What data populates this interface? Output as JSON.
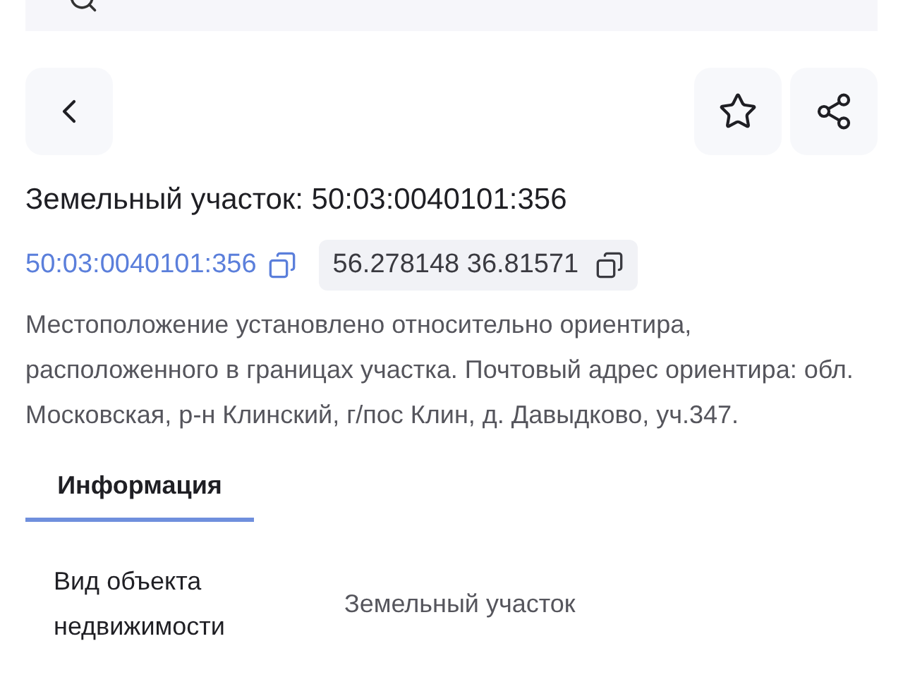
{
  "title": "Земельный участок: 50:03:0040101:356",
  "cadastral_link": "50:03:0040101:356",
  "coordinates": "56.278148 36.81571",
  "description": "Местоположение установлено относительно ориентира, расположенного в границах участка. Почтовый адрес ориентира: обл. Московская, р-н Клинский, г/пос Клин, д. Давыдково, уч.347.",
  "tabs": [
    {
      "label": "Информация",
      "selected": true
    }
  ],
  "info_rows": [
    {
      "label": "Вид объекта недвижимости",
      "value": "Земельный участок"
    }
  ]
}
